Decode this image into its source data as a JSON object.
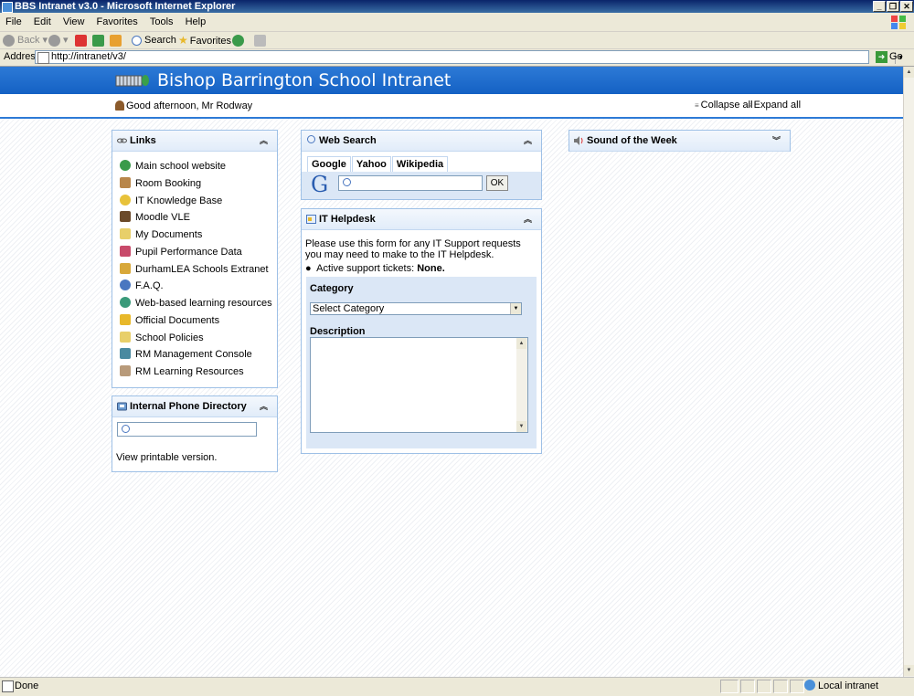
{
  "window": {
    "title": "BBS Intranet v3.0 - Microsoft Internet Explorer"
  },
  "menu": [
    "File",
    "Edit",
    "View",
    "Favorites",
    "Tools",
    "Help"
  ],
  "toolbar": {
    "back": "Back",
    "search": "Search",
    "favorites": "Favorites"
  },
  "address": {
    "label": "Address",
    "url": "http://intranet/v3/",
    "go": "Go"
  },
  "header": {
    "title": "Bishop Barrington School Intranet",
    "greeting": "Good afternoon, Mr Rodway",
    "collapse_all": "Collapse all",
    "expand_all": "Expand all"
  },
  "links_panel": {
    "title": "Links",
    "items": [
      {
        "label": "Main school website",
        "icon": "globe-icon",
        "color": "#3a9a4a"
      },
      {
        "label": "Room Booking",
        "icon": "book-icon",
        "color": "#b8864a"
      },
      {
        "label": "IT Knowledge Base",
        "icon": "lightbulb-icon",
        "color": "#e8c23a"
      },
      {
        "label": "Moodle VLE",
        "icon": "mortarboard-icon",
        "color": "#6b4a2a"
      },
      {
        "label": "My Documents",
        "icon": "folder-icon",
        "color": "#e8cf6a"
      },
      {
        "label": "Pupil Performance Data",
        "icon": "bar-chart-icon",
        "color": "#c84a6a"
      },
      {
        "label": "DurhamLEA Schools Extranet",
        "icon": "crest-icon",
        "color": "#d8a83a"
      },
      {
        "label": "F.A.Q.",
        "icon": "help-icon",
        "color": "#4a77c0"
      },
      {
        "label": "Web-based learning resources",
        "icon": "globe-icon",
        "color": "#3a9a7a"
      },
      {
        "label": "Official Documents",
        "icon": "star-icon",
        "color": "#e8b82a"
      },
      {
        "label": "School Policies",
        "icon": "folder-icon",
        "color": "#e8cf6a"
      },
      {
        "label": "RM Management Console",
        "icon": "console-icon",
        "color": "#4a8aa0"
      },
      {
        "label": "RM Learning Resources",
        "icon": "box-icon",
        "color": "#b89a7a"
      }
    ]
  },
  "phone_panel": {
    "title": "Internal Phone Directory",
    "printable": "View printable version."
  },
  "web_search": {
    "title": "Web Search",
    "tabs": [
      "Google",
      "Yahoo",
      "Wikipedia"
    ],
    "logo_letter": "G",
    "button": "OK"
  },
  "helpdesk": {
    "title": "IT Helpdesk",
    "intro": "Please use this form for any IT Support requests you may need to make to the IT Helpdesk.",
    "tickets_label": "Active support tickets: ",
    "tickets_value": "None.",
    "category_label": "Category",
    "category_selected": "Select Category",
    "description_label": "Description"
  },
  "sound_panel": {
    "title": "Sound of the Week"
  },
  "status": {
    "text": "Done",
    "zone": "Local intranet"
  },
  "colors": {
    "banner": "#1461c4",
    "panel_border": "#9ec0e6",
    "form_bg": "#dbe7f6"
  }
}
